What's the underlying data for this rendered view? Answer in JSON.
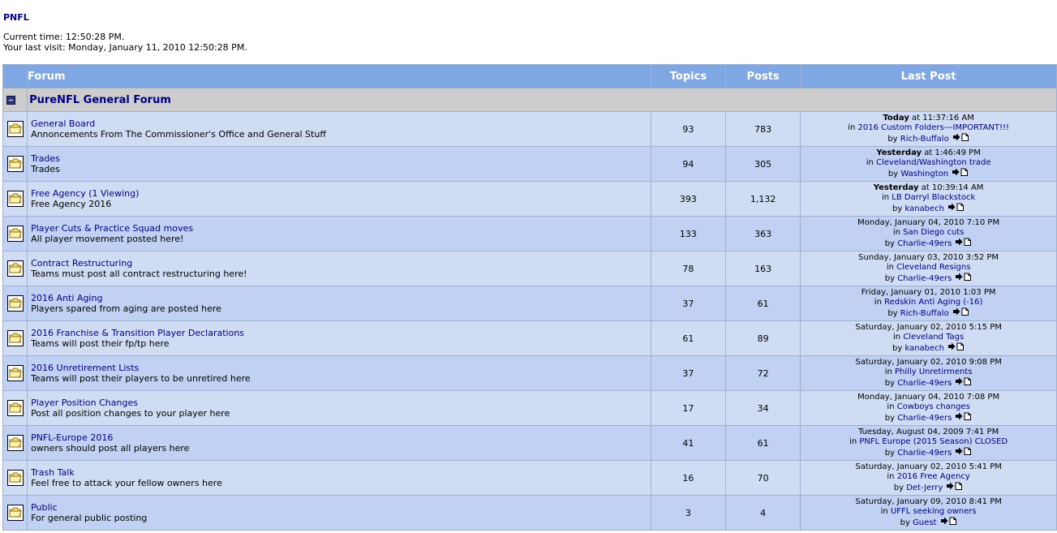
{
  "site": {
    "title": "PNFL",
    "current_time": "Current time: 12:50:28 PM.",
    "last_visit": "Your last visit: Monday, January 11, 2010 12:50:28 PM."
  },
  "table": {
    "headers": {
      "forum": "Forum",
      "topics": "Topics",
      "posts": "Posts",
      "last_post": "Last Post"
    },
    "category": {
      "title": "PureNFL General Forum",
      "toggle_icon": "collapse-minus-icon"
    },
    "rows": [
      {
        "name": "General Board",
        "viewing": "",
        "desc": "Annoncements From The Commissioner's Office and General Stuff",
        "topics": "93",
        "posts": "783",
        "last_day": "Today",
        "last_time": " at 11:37:16 AM",
        "last_in": "2016 Custom Folders---IMPORTANT!!!",
        "last_by": "Rich-Buffalo"
      },
      {
        "name": "Trades",
        "viewing": "",
        "desc": "Trades",
        "topics": "94",
        "posts": "305",
        "last_day": "Yesterday",
        "last_time": " at 1:46:49 PM",
        "last_in": "Cleveland/Washington trade",
        "last_by": "Washington"
      },
      {
        "name": "Free Agency",
        "viewing": "(1 Viewing)",
        "desc": "Free Agency 2016",
        "topics": "393",
        "posts": "1,132",
        "last_day": "Yesterday",
        "last_time": " at 10:39:14 AM",
        "last_in": "LB Darryl Blackstock",
        "last_by": "kanabech"
      },
      {
        "name": "Player Cuts & Practice Squad moves",
        "viewing": "",
        "desc": "All player movement posted here!",
        "topics": "133",
        "posts": "363",
        "last_day": "",
        "last_time": "Monday, January 04, 2010 7:10 PM",
        "last_in": "San Diego cuts",
        "last_by": "Charlie-49ers"
      },
      {
        "name": "Contract Restructuring",
        "viewing": "",
        "desc": "Teams must post all contract restructuring here!",
        "topics": "78",
        "posts": "163",
        "last_day": "",
        "last_time": "Sunday, January 03, 2010 3:52 PM",
        "last_in": "Cleveland Resigns",
        "last_by": "Charlie-49ers"
      },
      {
        "name": "2016 Anti Aging",
        "viewing": "",
        "desc": "Players spared from aging are posted here",
        "topics": "37",
        "posts": "61",
        "last_day": "",
        "last_time": "Friday, January 01, 2010 1:03 PM",
        "last_in": "Redskin Anti Aging (-16)",
        "last_by": "Rich-Buffalo"
      },
      {
        "name": "2016 Franchise & Transition Player Declarations",
        "viewing": "",
        "desc": "Teams will post their fp/tp here",
        "topics": "61",
        "posts": "89",
        "last_day": "",
        "last_time": "Saturday, January 02, 2010 5:15 PM",
        "last_in": "Cleveland Tags",
        "last_by": "kanabech"
      },
      {
        "name": "2016 Unretirement Lists",
        "viewing": "",
        "desc": "Teams will post their players to be unretired here",
        "topics": "37",
        "posts": "72",
        "last_day": "",
        "last_time": "Saturday, January 02, 2010 9:08 PM",
        "last_in": "Philly Unretirments",
        "last_by": "Charlie-49ers"
      },
      {
        "name": "Player Position Changes",
        "viewing": "",
        "desc": "Post all position changes to your player here",
        "topics": "17",
        "posts": "34",
        "last_day": "",
        "last_time": "Monday, January 04, 2010 7:08 PM",
        "last_in": "Cowboys changes",
        "last_by": "Charlie-49ers"
      },
      {
        "name": "PNFL-Europe 2016",
        "viewing": "",
        "desc": "owners should post all players here",
        "topics": "41",
        "posts": "61",
        "last_day": "",
        "last_time": "Tuesday, August 04, 2009 7:41 PM",
        "last_in": "PNFL Europe (2015 Season) CLOSED",
        "last_by": "Charlie-49ers"
      },
      {
        "name": "Trash Talk",
        "viewing": "",
        "desc": "Feel free to attack your fellow owners here",
        "topics": "16",
        "posts": "70",
        "last_day": "",
        "last_time": "Saturday, January 02, 2010 5:41 PM",
        "last_in": "2016 Free Agency",
        "last_by": "Det-Jerry"
      },
      {
        "name": "Public",
        "viewing": "",
        "desc": "For general public posting",
        "topics": "3",
        "posts": "4",
        "last_day": "",
        "last_time": "Saturday, January 09, 2010 8:41 PM",
        "last_in": "UFFL seeking owners",
        "last_by": "Guest"
      }
    ]
  },
  "labels": {
    "in_prefix": "in ",
    "by_prefix": "by "
  },
  "icons": {
    "forum_icon": "folder-icon",
    "go_to_post_icon": "go-to-last-post-icon"
  },
  "colors": {
    "header_bg": "#7fa7e3",
    "category_bg": "#cccccc",
    "row_odd": "#d0dcf4",
    "row_even": "#c0d1f3",
    "link": "#000080"
  }
}
